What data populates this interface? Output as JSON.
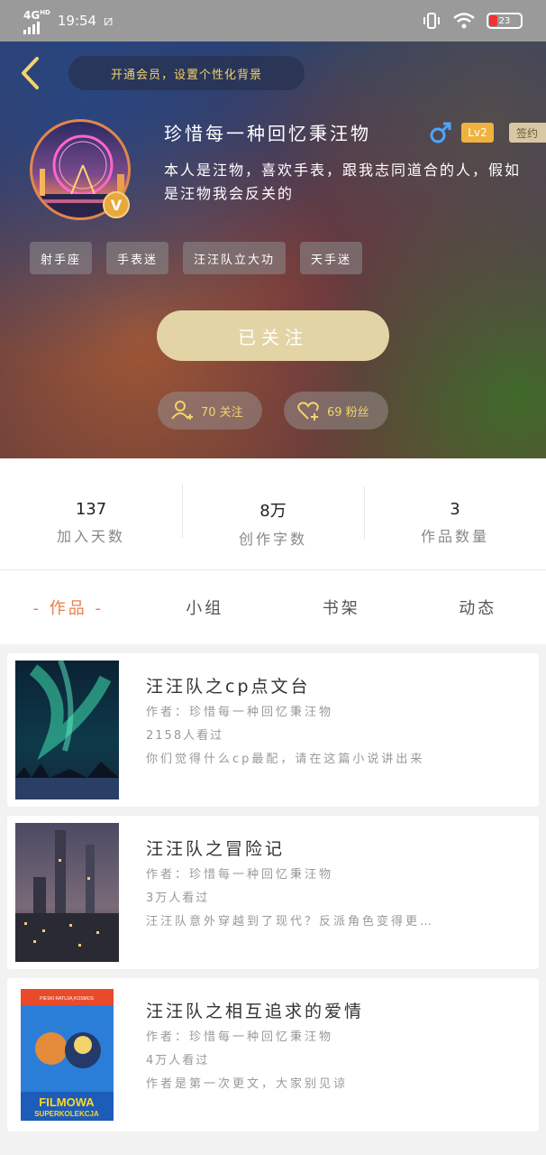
{
  "status_bar": {
    "network": "4G",
    "network_sup": "HD",
    "time": "19:54",
    "battery": "23"
  },
  "header": {
    "vip_banner": "开通会员，设置个性化背景"
  },
  "profile": {
    "username": "珍惜每一种回忆秉汪物",
    "level": "Lv2",
    "sign_badge": "签约",
    "vip_badge": "V",
    "bio": "本人是汪物，喜欢手表，跟我志同道合的人，假如是汪物我会反关的",
    "tags": [
      "射手座",
      "手表迷",
      "汪汪队立大功",
      "天手迷"
    ],
    "follow_button": "已关注",
    "following_count": "70 关注",
    "fans_count": "69 粉丝"
  },
  "stats": [
    {
      "value": "137",
      "label": "加入天数"
    },
    {
      "value": "8万",
      "label": "创作字数"
    },
    {
      "value": "3",
      "label": "作品数量"
    }
  ],
  "tabs": [
    {
      "label": "- 作品 -"
    },
    {
      "label": "小组"
    },
    {
      "label": "书架"
    },
    {
      "label": "动态"
    }
  ],
  "works": [
    {
      "title": "汪汪队之cp点文台",
      "author": "作者：珍惜每一种回忆秉汪物",
      "views": "2158人看过",
      "desc": "你们觉得什么cp最配，请在这篇小说讲出来"
    },
    {
      "title": "汪汪队之冒险记",
      "author": "作者：珍惜每一种回忆秉汪物",
      "views": "3万人看过",
      "desc": "汪汪队意外穿越到了现代？反派角色变得更…"
    },
    {
      "title": "汪汪队之相互追求的爱情",
      "author": "作者：珍惜每一种回忆秉汪物",
      "views": "4万人看过",
      "desc": "作者是第一次更文，大家别见谅"
    }
  ],
  "cover3": {
    "top": "PIESKI RATUJĄ KOSMOS",
    "bottom1": "FILMOWA",
    "bottom2": "SUPERKOLEKCJA"
  }
}
